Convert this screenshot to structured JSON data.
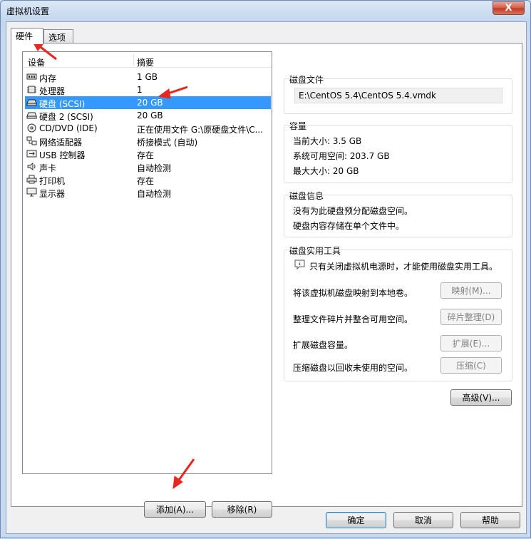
{
  "window": {
    "title": "虚拟机设置",
    "close_label": "X"
  },
  "tabs": [
    {
      "label": "硬件"
    },
    {
      "label": "选项"
    }
  ],
  "device_list": {
    "headers": {
      "device": "设备",
      "summary": "摘要"
    },
    "rows": [
      {
        "name": "内存",
        "summary": "1 GB",
        "icon": "memory-icon"
      },
      {
        "name": "处理器",
        "summary": "1",
        "icon": "cpu-icon"
      },
      {
        "name": "硬盘 (SCSI)",
        "summary": "20 GB",
        "icon": "hard-disk-icon",
        "selected": true
      },
      {
        "name": "硬盘 2 (SCSI)",
        "summary": "20 GB",
        "icon": "hard-disk-icon"
      },
      {
        "name": "CD/DVD (IDE)",
        "summary": "正在使用文件 G:\\原硬盘文件\\C...",
        "icon": "cd-dvd-icon"
      },
      {
        "name": "网络适配器",
        "summary": "桥接模式 (自动)",
        "icon": "network-icon"
      },
      {
        "name": "USB 控制器",
        "summary": "存在",
        "icon": "usb-icon"
      },
      {
        "name": "声卡",
        "summary": "自动检测",
        "icon": "sound-icon"
      },
      {
        "name": "打印机",
        "summary": "存在",
        "icon": "printer-icon"
      },
      {
        "name": "显示器",
        "summary": "自动检测",
        "icon": "display-icon"
      }
    ]
  },
  "list_buttons": {
    "add": "添加(A)...",
    "remove": "移除(R)"
  },
  "disk_file": {
    "title": "磁盘文件",
    "path": "E:\\CentOS 5.4\\CentOS 5.4.vmdk"
  },
  "capacity": {
    "title": "容量",
    "current": "当前大小: 3.5 GB",
    "available": "系统可用空间: 203.7 GB",
    "max": "最大大小: 20 GB"
  },
  "disk_info": {
    "title": "磁盘信息",
    "line1": "没有为此硬盘预分配磁盘空间。",
    "line2": "硬盘内容存储在单个文件中。"
  },
  "utilities": {
    "title": "磁盘实用工具",
    "note": "只有关闭虚拟机电源时，才能使用磁盘实用工具。",
    "map_label": "将该虚拟机磁盘映射到本地卷。",
    "map_button": "映射(M)...",
    "defrag_label": "整理文件碎片并整合可用空间。",
    "defrag_button": "碎片整理(D)",
    "expand_label": "扩展磁盘容量。",
    "expand_button": "扩展(E)...",
    "compact_label": "压缩磁盘以回收未使用的空间。",
    "compact_button": "压缩(C)"
  },
  "advanced_button": "高级(V)...",
  "footer": {
    "ok": "确定",
    "cancel": "取消",
    "help": "帮助"
  },
  "colors": {
    "selection": "#3399ff",
    "annotation_arrow": "#e8261c"
  }
}
